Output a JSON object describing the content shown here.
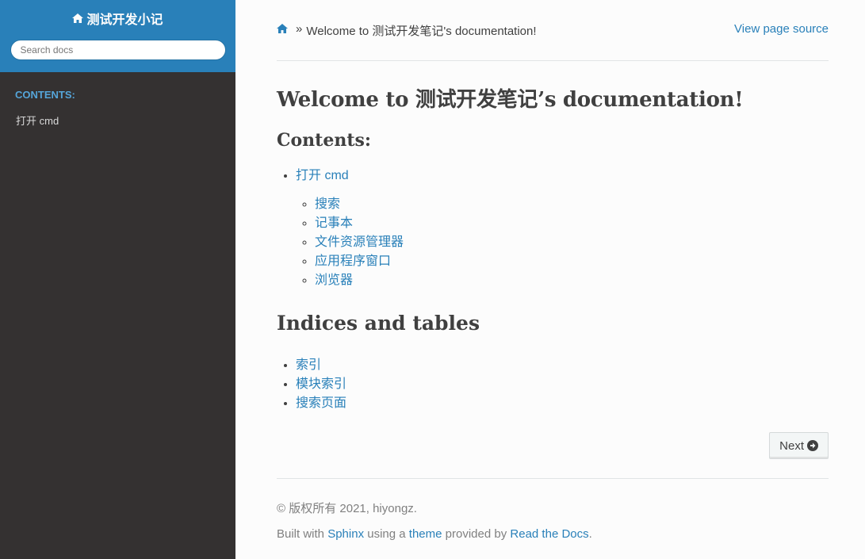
{
  "sidebar": {
    "project_name": "测试开发小记",
    "search_placeholder": "Search docs",
    "caption": "CONTENTS:",
    "items": [
      {
        "label": "打开 cmd"
      }
    ]
  },
  "breadcrumb": {
    "separator": "»",
    "current": "Welcome to 测试开发笔记's documentation!",
    "view_source": "View page source"
  },
  "main": {
    "title": "Welcome to 测试开发笔记’s documentation!",
    "contents_heading": "Contents:",
    "toc": {
      "label": "打开 cmd",
      "children": [
        "搜索",
        "记事本",
        "文件资源管理器",
        "应用程序窗口",
        "浏览器"
      ]
    },
    "indices_heading": "Indices and tables",
    "indices": [
      "索引",
      "模块索引",
      "搜索页面"
    ],
    "next_label": "Next"
  },
  "footer": {
    "copyright": "© 版权所有 2021, hiyongz.",
    "built_with": "Built with",
    "sphinx": "Sphinx",
    "using_a": "using a",
    "theme": "theme",
    "provided_by": "provided by",
    "rtd": "Read the Docs",
    "period": "."
  },
  "colors": {
    "sidebar_top": "#2980b9",
    "sidebar_bg": "#343131",
    "link": "#2980b9",
    "caption": "#55a5d9"
  },
  "icons": [
    "home-icon",
    "circle-arrow-right-icon"
  ]
}
